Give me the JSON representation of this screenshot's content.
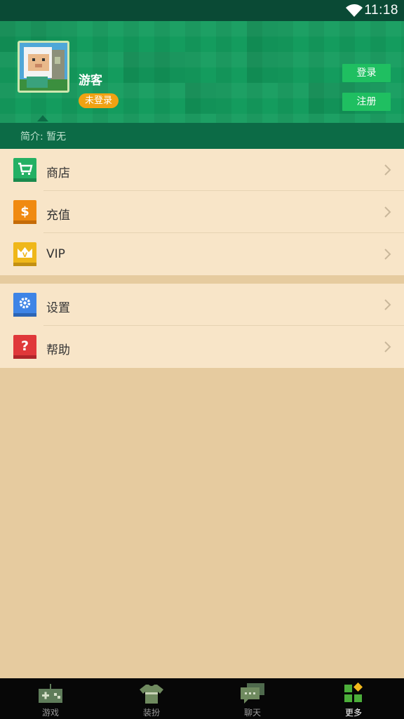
{
  "status_bar": {
    "time": "11:18"
  },
  "profile": {
    "username": "游客",
    "login_status": "未登录",
    "login_button": "登录",
    "register_button": "注册",
    "intro": "简介: 暂无"
  },
  "menu_group_1": [
    {
      "label": "商店",
      "icon": "cart-icon",
      "color": "#24b064"
    },
    {
      "label": "充值",
      "icon": "dollar-icon",
      "color": "#f08a11"
    },
    {
      "label": "VIP",
      "icon": "crown-icon",
      "color": "#efb71a"
    }
  ],
  "menu_group_2": [
    {
      "label": "设置",
      "icon": "gear-icon",
      "color": "#3e84e6"
    },
    {
      "label": "帮助",
      "icon": "question-icon",
      "color": "#e0383a"
    }
  ],
  "bottom_nav": [
    {
      "label": "游戏",
      "icon": "gamepad-icon",
      "active": false
    },
    {
      "label": "装扮",
      "icon": "shirt-icon",
      "active": false
    },
    {
      "label": "聊天",
      "icon": "chat-icon",
      "active": false
    },
    {
      "label": "更多",
      "icon": "more-grid-icon",
      "active": true
    }
  ],
  "colors": {
    "header_green": "#149c5e",
    "dark_green": "#0c6b46",
    "button_green": "#1fbf61",
    "badge_orange": "#f0a213",
    "menu_bg": "#f8e5c8",
    "page_bg": "#e6cb9f"
  }
}
